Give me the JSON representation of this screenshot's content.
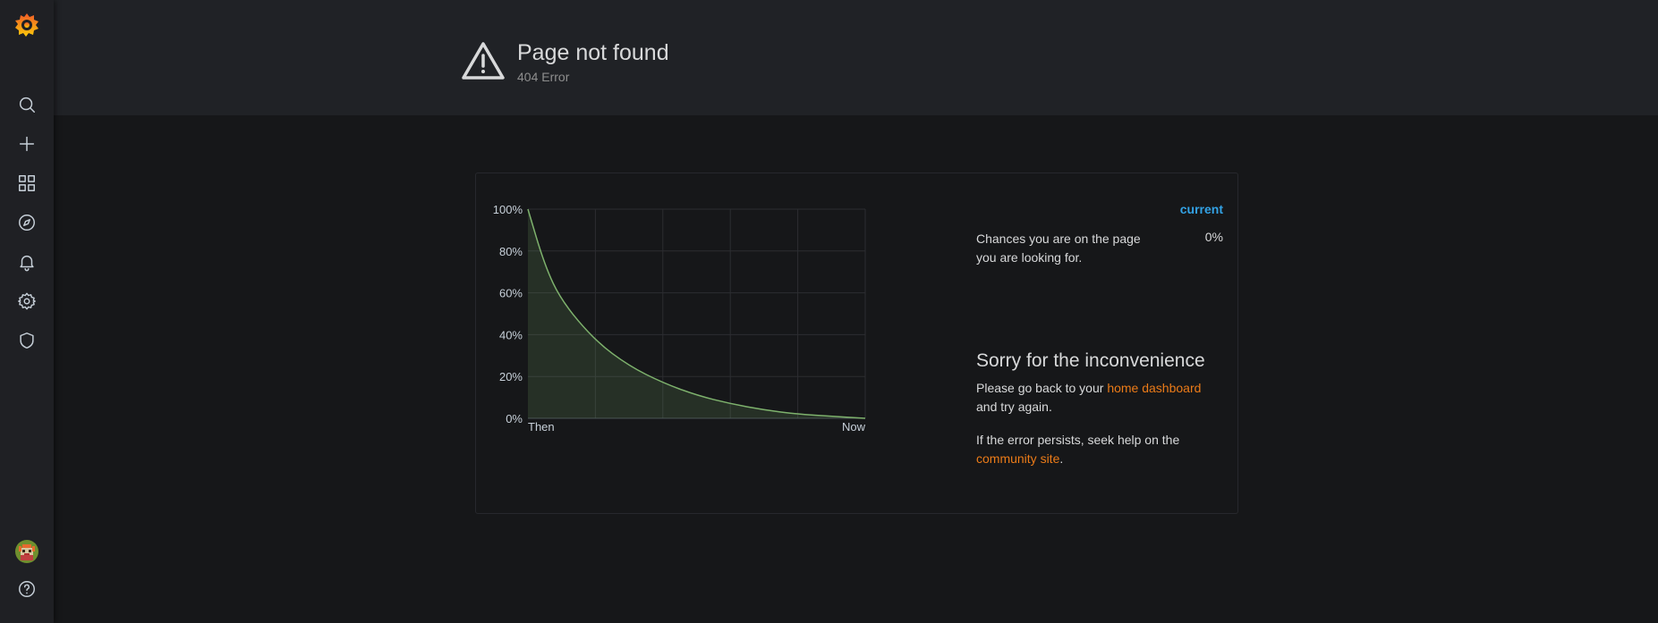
{
  "header": {
    "title": "Page not found",
    "subtitle": "404 Error",
    "warning_icon": "warning-triangle-icon"
  },
  "sidebar": {
    "logo_icon": "grafana-logo-icon",
    "items": [
      {
        "name": "search",
        "icon": "search-icon"
      },
      {
        "name": "create",
        "icon": "plus-icon"
      },
      {
        "name": "dashboards",
        "icon": "apps-icon"
      },
      {
        "name": "explore",
        "icon": "compass-icon"
      },
      {
        "name": "alerting",
        "icon": "bell-icon"
      },
      {
        "name": "configuration",
        "icon": "gear-icon"
      },
      {
        "name": "server-admin",
        "icon": "shield-icon"
      }
    ],
    "bottom": [
      {
        "name": "profile",
        "icon": "avatar"
      },
      {
        "name": "help",
        "icon": "question-circle-icon"
      }
    ]
  },
  "chart_data": {
    "type": "area",
    "x": [
      "Then",
      "Now"
    ],
    "xtick_labels": [
      "Then",
      "Now"
    ],
    "ytick_labels": [
      "0%",
      "20%",
      "40%",
      "60%",
      "80%",
      "100%"
    ],
    "ylim": [
      0,
      100
    ],
    "series": [
      {
        "name": "Chances you are on the page you are looking for.",
        "color": "#7eb26d",
        "x_frac": [
          0,
          0.05,
          0.1,
          0.2,
          0.3,
          0.4,
          0.5,
          0.6,
          0.7,
          0.8,
          0.9,
          1.0
        ],
        "values": [
          100,
          73,
          56,
          37,
          25,
          17,
          11,
          7,
          4,
          2,
          1,
          0
        ]
      }
    ],
    "grid": true,
    "legend": {
      "header": "current",
      "entries": [
        {
          "label": "Chances you are on the page you are looking for.",
          "value": "0%"
        }
      ]
    }
  },
  "message": {
    "title": "Sorry for the inconvenience",
    "p1_before": "Please go back to your ",
    "p1_link": "home dashboard",
    "p1_after": "and try again.",
    "p2_before": "If the error persists, seek help on the",
    "p2_link": "community site",
    "p2_after": "."
  },
  "colors": {
    "link": "#eb7b18",
    "legend_header": "#33a2e5",
    "series": "#7eb26d"
  }
}
